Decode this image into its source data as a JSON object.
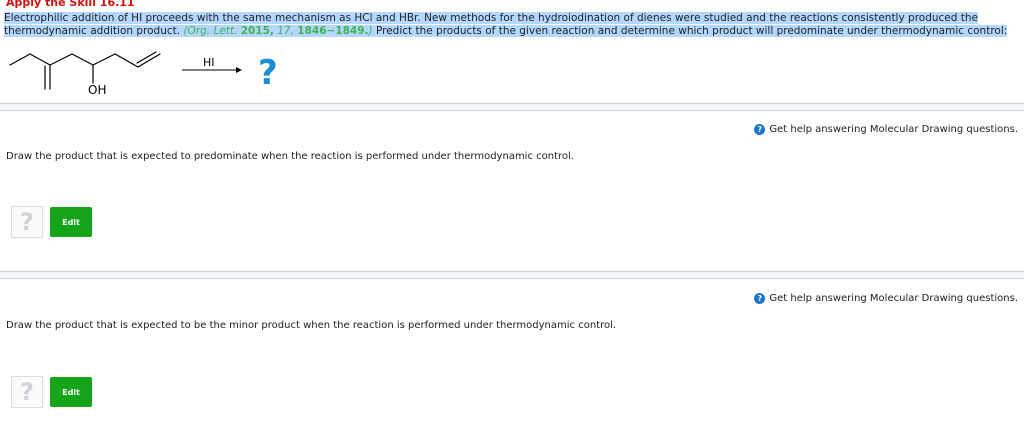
{
  "header": {
    "title": "Apply the Skill 16.11",
    "intro_line1": "Electrophilic addition of HI proceeds with the same mechanism as HCl and HBr. New methods for the hydroiodination of dienes were studied and the reactions consistently produced the",
    "intro_line2_pre": "thermodynamic addition product. ",
    "ref_journal": "(Org. Lett.",
    "ref_year": "2015,",
    "ref_volume": "17,",
    "ref_pages": "1846−1849.",
    "ref_close": ")",
    "intro_line2_post": " Predict the products of the given reaction and determine which product will predominate under thermodynamic control:"
  },
  "scheme": {
    "oh_label": "OH",
    "reagent": "HI",
    "question": "?"
  },
  "questions": [
    {
      "help": "Get help answering Molecular Drawing questions.",
      "prompt": "Draw the product that is expected to predominate when the reaction is performed under thermodynamic control.",
      "placeholder": "?",
      "edit_label": "Edit"
    },
    {
      "help": "Get help answering Molecular Drawing questions.",
      "prompt": "Draw the product that is expected to be the minor product when the reaction is performed under thermodynamic control.",
      "placeholder": "?",
      "edit_label": "Edit"
    }
  ],
  "colors": {
    "title_red": "#d0120f",
    "ref_green": "#3fb34f",
    "edit_green": "#16a41b",
    "help_blue": "#1a74c7"
  }
}
